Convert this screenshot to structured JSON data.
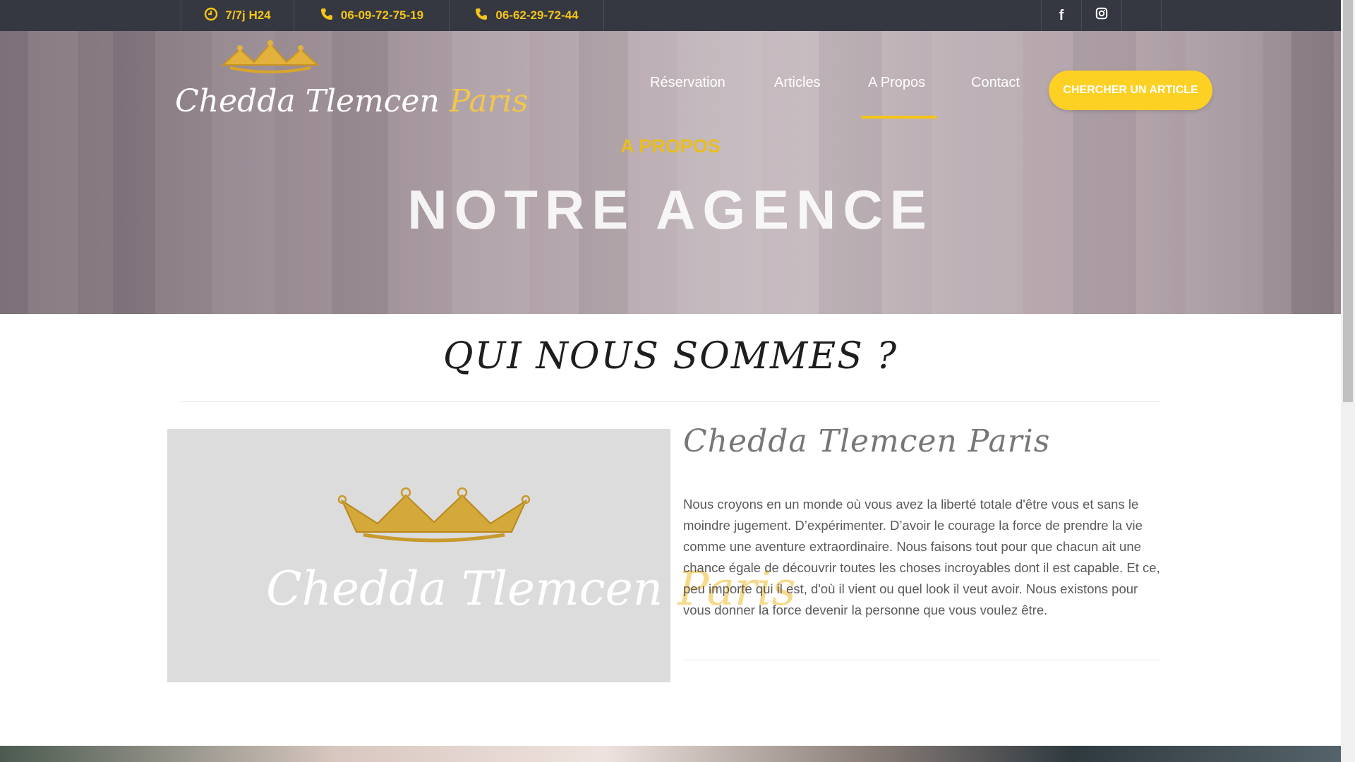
{
  "topbar": {
    "hours": {
      "icon": "clock-icon",
      "text": "7/7j H24"
    },
    "phone1": {
      "icon": "phone-icon",
      "text": "06-09-72-75-19"
    },
    "phone2": {
      "icon": "phone-icon",
      "text": "06-62-29-72-44"
    },
    "social": [
      {
        "icon": "facebook-icon",
        "glyph": "f"
      },
      {
        "icon": "instagram-icon",
        "glyph": ""
      },
      {
        "icon": "empty-social-slot",
        "glyph": ""
      }
    ]
  },
  "logo": {
    "part1": "Chedda ",
    "part2": "Tlemcen ",
    "part3": "Paris"
  },
  "nav": {
    "items": [
      "Réservation",
      "Articles",
      "A Propos",
      "Contact"
    ],
    "active": "A Propos",
    "cta": "CHERCHER UN ARTICLE"
  },
  "hero": {
    "eyebrow": "A PROPOS",
    "title": "NOTRE AGENCE"
  },
  "about": {
    "section_title": "QUI NOUS SOMMES ?",
    "image_logo": {
      "part1": "Chedda ",
      "part2": "Tlemcen ",
      "part3": "Paris"
    },
    "company_name": "Chedda Tlemcen Paris",
    "description": "Nous croyons en un monde où vous avez la liberté totale d'être vous et sans le moindre jugement. D’expérimenter. D’avoir le courage la force de prendre la vie comme une aventure extraordinaire. Nous faisons tout pour que chacun ait une chance égale de découvrir toutes les choses incroyables dont il est capable. Et ce, peu importe qui il est, d'où il vient ou quel look il veut avoir. Nous existons pour vous donner la force devenir la personne que vous voulez être."
  },
  "colors": {
    "accent": "#fdd024",
    "topbar_bg": "#353841",
    "topbar_text": "#f5c518",
    "gold": "#e9bd1f"
  }
}
